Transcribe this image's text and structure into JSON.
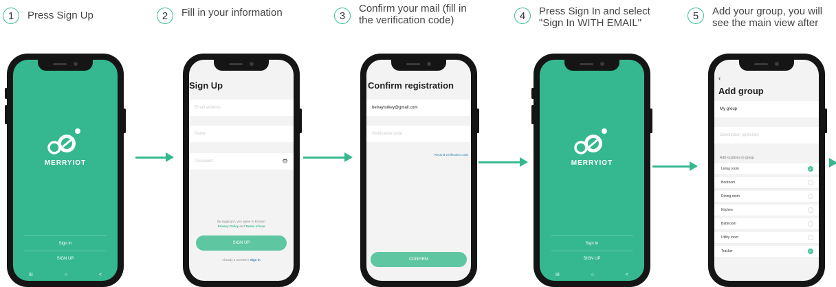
{
  "steps": [
    {
      "num": "1",
      "text": "Press Sign Up"
    },
    {
      "num": "2",
      "text": "Fill in your information"
    },
    {
      "num": "3",
      "text": "Confirm your mail (fill in\nthe verification code)"
    },
    {
      "num": "4",
      "text": "Press Sign In and select\n\"Sign In WITH EMAIL\""
    },
    {
      "num": "5",
      "text": "Add your group, you will\nsee the main view after"
    }
  ],
  "welcome": {
    "brand": "MERRYIOT",
    "sign_in": "Sign In",
    "sign_up": "SIGN UP",
    "nav_recents": "III",
    "nav_home": "○",
    "nav_back": "<"
  },
  "signup": {
    "title": "Sign Up",
    "email_placeholder": "Email address",
    "name_placeholder": "Name",
    "password_placeholder": "Password",
    "eye": "👁",
    "terms_line1": "By logging in, you agree to Browan",
    "terms_policy": "Privacy Policy",
    "terms_and": "and",
    "terms_tou": "Terms of Use",
    "button": "SIGN UP",
    "member_text": "Already a member?",
    "member_link": "Sign in"
  },
  "confirm": {
    "title": "Confirm registration",
    "email_value": "betrayturkey@gmail.com",
    "code_placeholder": "Verification code",
    "resend": "Resend verification code",
    "button": "CONFIRM"
  },
  "add_group": {
    "back": "‹",
    "title": "Add group",
    "name_value": "My group",
    "desc_placeholder": "Description (optional)",
    "locations_label": "Add locations to group",
    "locations": [
      {
        "name": "Living room",
        "checked": true
      },
      {
        "name": "Bedroom",
        "checked": false
      },
      {
        "name": "Dining room",
        "checked": false
      },
      {
        "name": "Kitchen",
        "checked": false
      },
      {
        "name": "Bathroom",
        "checked": false
      },
      {
        "name": "Utility room",
        "checked": false
      },
      {
        "name": "Tracker",
        "checked": true
      }
    ],
    "check_mark": "✓"
  },
  "colors": {
    "accent": "#35b88f",
    "button": "#5ec7a2",
    "dark": "#151515",
    "screen_bg": "#f3f3f3"
  }
}
